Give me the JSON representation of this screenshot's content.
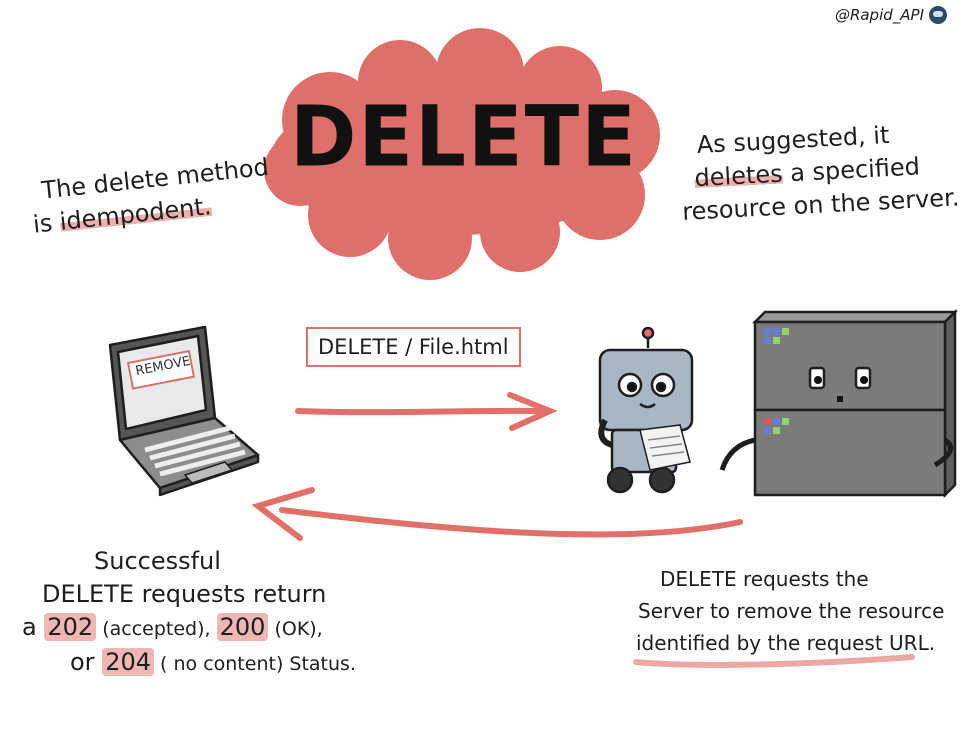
{
  "handle": "@Rapid_API",
  "title": "DELETE",
  "left_note": {
    "line1": "The delete method",
    "line2_prefix": "is ",
    "line2_highlight": "idempodent."
  },
  "right_note": {
    "line1": "As suggested, it",
    "line2_highlight": "deletes",
    "line2_suffix": " a specified",
    "line3": "resource on the server."
  },
  "laptop_screen_label": "REMOVE",
  "request_label": "DELETE / File.html",
  "bottom_left": {
    "line1": "Successful",
    "line2": "DELETE requests return",
    "line3_prefix": "a ",
    "code1": "202",
    "code1_text": " (accepted), ",
    "code2": "200",
    "code2_text": " (OK),",
    "line4_prefix": "or ",
    "code3": "204",
    "code3_text": " ( no content) Status."
  },
  "bottom_right": {
    "line1": "DELETE requests the",
    "line2": "Server to remove the resource",
    "line3_highlight": "identified by the request URL."
  },
  "colors": {
    "accent": "#e07068",
    "cloud": "#de6f69",
    "server": "#7b7b7b",
    "robot": "#a9b6c4"
  }
}
